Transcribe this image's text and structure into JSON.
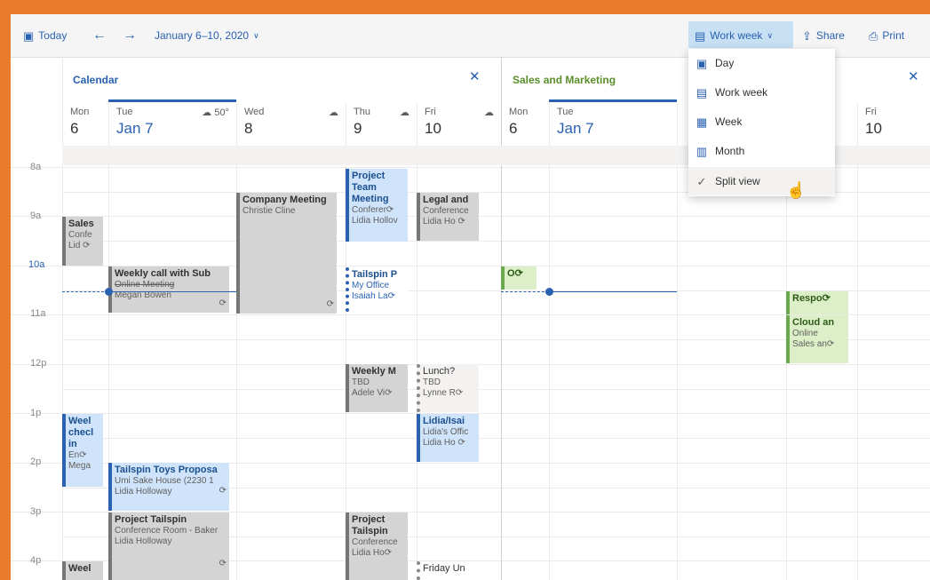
{
  "toolbar": {
    "today_label": "Today",
    "date_range": "January 6–10, 2020",
    "view_label": "Work week",
    "share_label": "Share",
    "print_label": "Print"
  },
  "view_menu": {
    "items": [
      {
        "label": "Day",
        "icon": "calendar-day-icon"
      },
      {
        "label": "Work week",
        "icon": "calendar-workweek-icon"
      },
      {
        "label": "Week",
        "icon": "calendar-week-icon"
      },
      {
        "label": "Month",
        "icon": "calendar-month-icon"
      },
      {
        "label": "Split view",
        "icon": "check-icon"
      }
    ]
  },
  "panes": {
    "left": {
      "title": "Calendar",
      "title_color": "#2a61b0",
      "days": [
        {
          "name": "Mon",
          "num": "6"
        },
        {
          "name": "Tue",
          "num": "Jan 7",
          "weather": "50°"
        },
        {
          "name": "Wed",
          "num": "8"
        },
        {
          "name": "Thu",
          "num": "9"
        },
        {
          "name": "Fri",
          "num": "10"
        }
      ]
    },
    "right": {
      "title": "Sales and Marketing",
      "title_color": "#5a8f2a",
      "days": [
        {
          "name": "Mon",
          "num": "6"
        },
        {
          "name": "Tue",
          "num": "Jan 7"
        },
        {
          "name": "Fri",
          "num": "10"
        }
      ]
    }
  },
  "hours": [
    "8a",
    "9a",
    "10a",
    "11a",
    "12p",
    "1p",
    "2p",
    "3p",
    "4p"
  ],
  "events": {
    "sales": {
      "title": "Sales",
      "line1": "Confe",
      "line2": "Lid"
    },
    "weekly_call": {
      "title": "Weekly call with Sub",
      "line1": "Online Meeting",
      "line2": "Megan Bowen"
    },
    "company_meeting": {
      "title": "Company Meeting",
      "line1": "Christie Cline"
    },
    "project_team": {
      "title": "Project Team Meeting",
      "line1": "Conferer",
      "line2": "Lidia Hollov"
    },
    "legal": {
      "title": "Legal and",
      "line1": "Conference",
      "line2": "Lidia Ho"
    },
    "tailspin_p": {
      "title": "Tailspin P",
      "line1": "My Office",
      "line2": "Isaiah La"
    },
    "weekly_m": {
      "title": "Weekly M",
      "line1": "TBD",
      "line2": "Adele Vi"
    },
    "lunch": {
      "title": "Lunch?",
      "line1": "TBD",
      "line2": "Lynne R"
    },
    "lidia_isaiah": {
      "title": "Lidia/Isai",
      "line1": "Lidia's Offic",
      "line2": "Lidia Ho"
    },
    "weekly_checkin": {
      "title": "Weel checl in",
      "line1": "En",
      "line2": "Mega"
    },
    "tailspin_toys": {
      "title": "Tailspin Toys Proposa",
      "line1": "Umi Sake House (2230 1",
      "line2": "Lidia Holloway"
    },
    "project_tailspin": {
      "title": "Project Tailspin",
      "line1": "Conference Room - Baker",
      "line2": "Lidia Holloway"
    },
    "project_tailspin_thu": {
      "title": "Project Tailspin",
      "line1": "Conference",
      "line2": "Lidia Ho"
    },
    "friday_un": {
      "title": "Friday Un"
    },
    "weel_bottom": {
      "title": "Weel"
    },
    "on_green": {
      "title": "O"
    },
    "respo": {
      "title": "Respo"
    },
    "cloud": {
      "title": "Cloud an",
      "line1": "Online",
      "line2": "Sales an"
    }
  }
}
